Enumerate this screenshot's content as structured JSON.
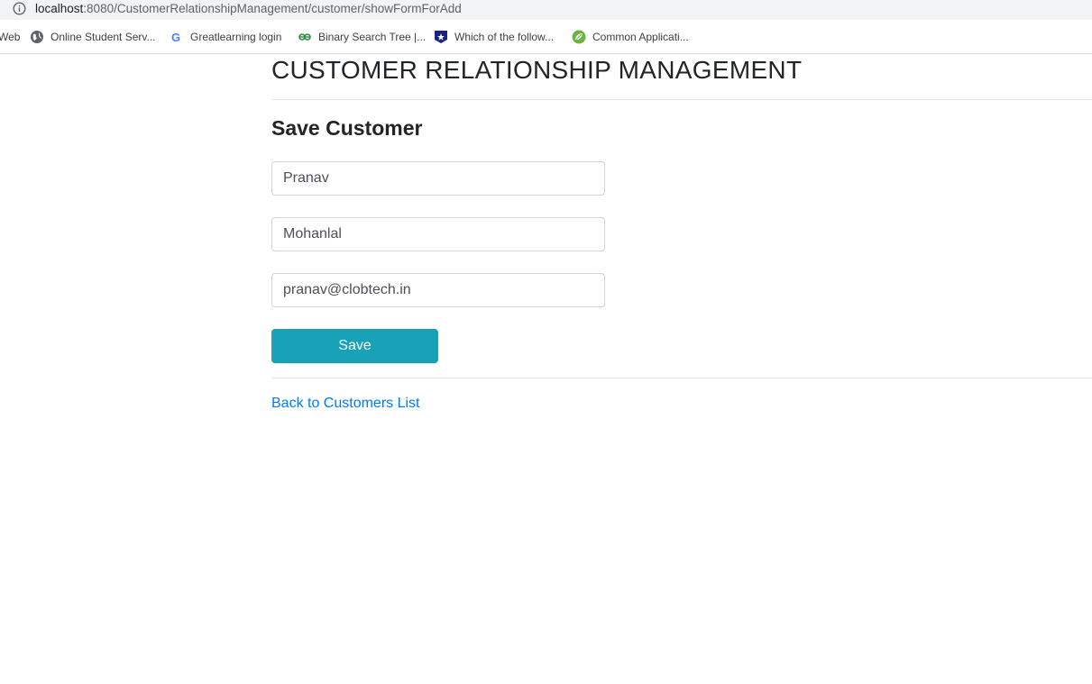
{
  "browser": {
    "url_host": "localhost",
    "url_rest": ":8080/CustomerRelationshipManagement/customer/showFormForAdd",
    "bookmarks": [
      {
        "label": "Web",
        "icon": "none"
      },
      {
        "label": "Online Student Serv...",
        "icon": "globe-icon"
      },
      {
        "label": "Greatlearning login",
        "icon": "google-icon"
      },
      {
        "label": "Binary Search Tree |...",
        "icon": "geeksforgeeks-icon"
      },
      {
        "label": "Which of the follow...",
        "icon": "star-shield-icon"
      },
      {
        "label": "Common Applicati...",
        "icon": "leaf-icon"
      }
    ]
  },
  "page": {
    "title": "CUSTOMER RELATIONSHIP MANAGEMENT",
    "subtitle": "Save Customer",
    "form": {
      "first_name": "Pranav",
      "last_name": "Mohanlal",
      "email": "pranav@clobtech.in",
      "save_label": "Save"
    },
    "back_link": "Back to Customers List"
  },
  "colors": {
    "save_button": "#17a2b8",
    "link": "#007bff"
  }
}
